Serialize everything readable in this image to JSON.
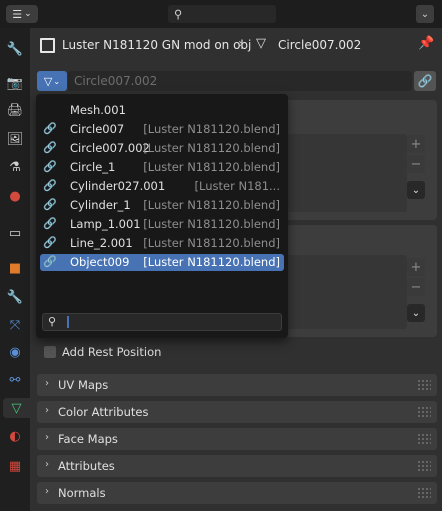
{
  "header": {
    "editor_icon": "properties-editor-icon",
    "search_icon": "search-icon",
    "dropdown_icon": "chevron-down-icon"
  },
  "tabs": [
    {
      "name": "tool-icon",
      "glyph": "🔧",
      "color": "#cfcfcf"
    },
    {
      "name": "render-icon",
      "glyph": "📷",
      "color": "#cfcfcf"
    },
    {
      "name": "output-icon",
      "glyph": "🖨",
      "color": "#cfcfcf"
    },
    {
      "name": "view-layer-icon",
      "glyph": "🖼",
      "color": "#cfcfcf"
    },
    {
      "name": "scene-icon",
      "glyph": "⚗",
      "color": "#cfcfcf"
    },
    {
      "name": "world-icon",
      "glyph": "●",
      "color": "#d2493e"
    },
    {
      "name": "collection-icon",
      "glyph": "▭",
      "color": "#cfcfcf"
    },
    {
      "name": "object-icon",
      "glyph": "■",
      "color": "#e07b2c"
    },
    {
      "name": "modifier-icon",
      "glyph": "🔧",
      "color": "#5b8fd6"
    },
    {
      "name": "particles-icon",
      "glyph": "⤧",
      "color": "#5b8fd6"
    },
    {
      "name": "physics-icon",
      "glyph": "◉",
      "color": "#5b8fd6"
    },
    {
      "name": "constraints-icon",
      "glyph": "⚯",
      "color": "#5b8fd6"
    },
    {
      "name": "data-icon",
      "glyph": "▽",
      "color": "#4fc27a"
    },
    {
      "name": "material-icon",
      "glyph": "◐",
      "color": "#d2493e"
    },
    {
      "name": "texture-icon",
      "glyph": "▦",
      "color": "#d2493e"
    }
  ],
  "breadcrumb": {
    "object_label": "Luster N181120 GN mod on obj",
    "separator": "›",
    "mesh_label": "Circle007.002"
  },
  "id_field": {
    "placeholder": "Circle007.002"
  },
  "dropdown": {
    "items": [
      {
        "name": "Mesh.001",
        "library": "",
        "linked": false
      },
      {
        "name": "Circle007",
        "library": "[Luster N181120.blend]",
        "linked": true
      },
      {
        "name": "Circle007.002",
        "library": "[Luster N181120.blend]",
        "linked": true
      },
      {
        "name": "Circle_1",
        "library": "[Luster N181120.blend]",
        "linked": true
      },
      {
        "name": "Cylinder027.001",
        "library": "[Luster N181...",
        "linked": true
      },
      {
        "name": "Cylinder_1",
        "library": "[Luster N181120.blend]",
        "linked": true
      },
      {
        "name": "Lamp_1.001",
        "library": "[Luster N181120.blend]",
        "linked": true
      },
      {
        "name": "Line_2.001",
        "library": "[Luster N181120.blend]",
        "linked": true
      },
      {
        "name": "Object009",
        "library": "[Luster N181120.blend]",
        "linked": true,
        "selected": true
      }
    ],
    "search_value": ""
  },
  "rest_position": {
    "label": "Add Rest Position"
  },
  "sections": [
    {
      "label": "UV Maps"
    },
    {
      "label": "Color Attributes"
    },
    {
      "label": "Face Maps"
    },
    {
      "label": "Attributes"
    },
    {
      "label": "Normals"
    }
  ],
  "colors": {
    "accent": "#4772b3",
    "panel": "#3d3d3d",
    "background": "#303030",
    "header": "#1d1d1d"
  }
}
